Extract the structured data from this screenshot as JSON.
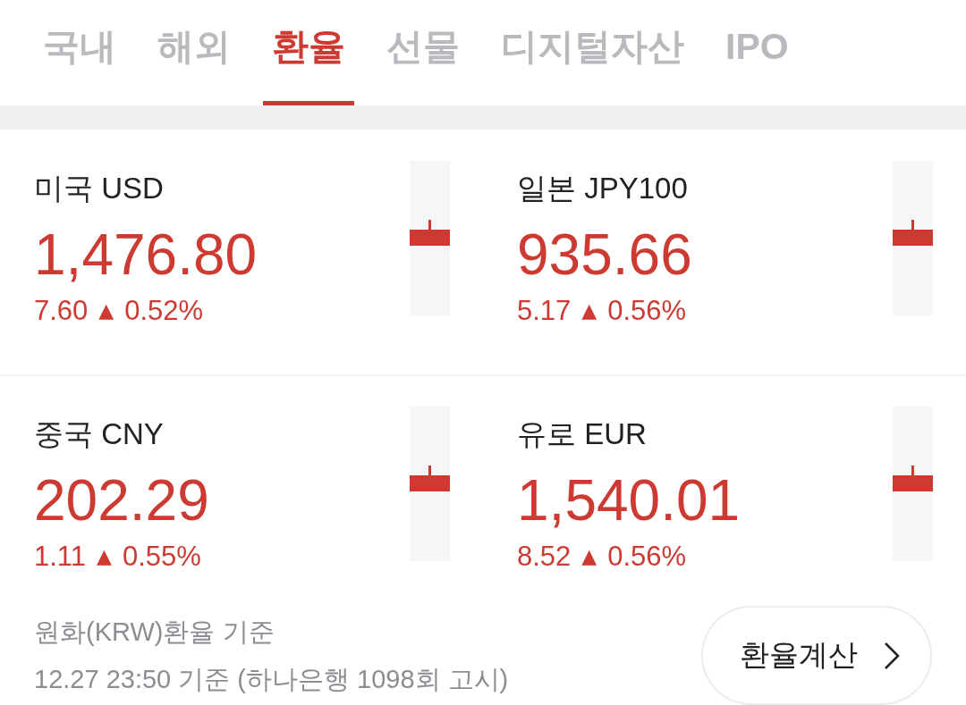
{
  "tabs": [
    {
      "label": "국내",
      "selected": false
    },
    {
      "label": "해외",
      "selected": false
    },
    {
      "label": "환율",
      "selected": true
    },
    {
      "label": "선물",
      "selected": false
    },
    {
      "label": "디지털자산",
      "selected": false
    },
    {
      "label": "IPO",
      "selected": false
    }
  ],
  "rates": [
    {
      "name": "미국 USD",
      "price": "1,476.80",
      "change": "7.60",
      "arrow": "▲",
      "percent": "0.52%"
    },
    {
      "name": "일본 JPY100",
      "price": "935.66",
      "change": "5.17",
      "arrow": "▲",
      "percent": "0.56%"
    },
    {
      "name": "중국 CNY",
      "price": "202.29",
      "change": "1.11",
      "arrow": "▲",
      "percent": "0.55%"
    },
    {
      "name": "유로 EUR",
      "price": "1,540.01",
      "change": "8.52",
      "arrow": "▲",
      "percent": "0.56%"
    }
  ],
  "footer": {
    "basis": "원화(KRW)환율 기준",
    "updated": "12.27 23:50 기준 (하나은행 1098회 고시)"
  },
  "calculator_button": {
    "label": "환율계산"
  }
}
